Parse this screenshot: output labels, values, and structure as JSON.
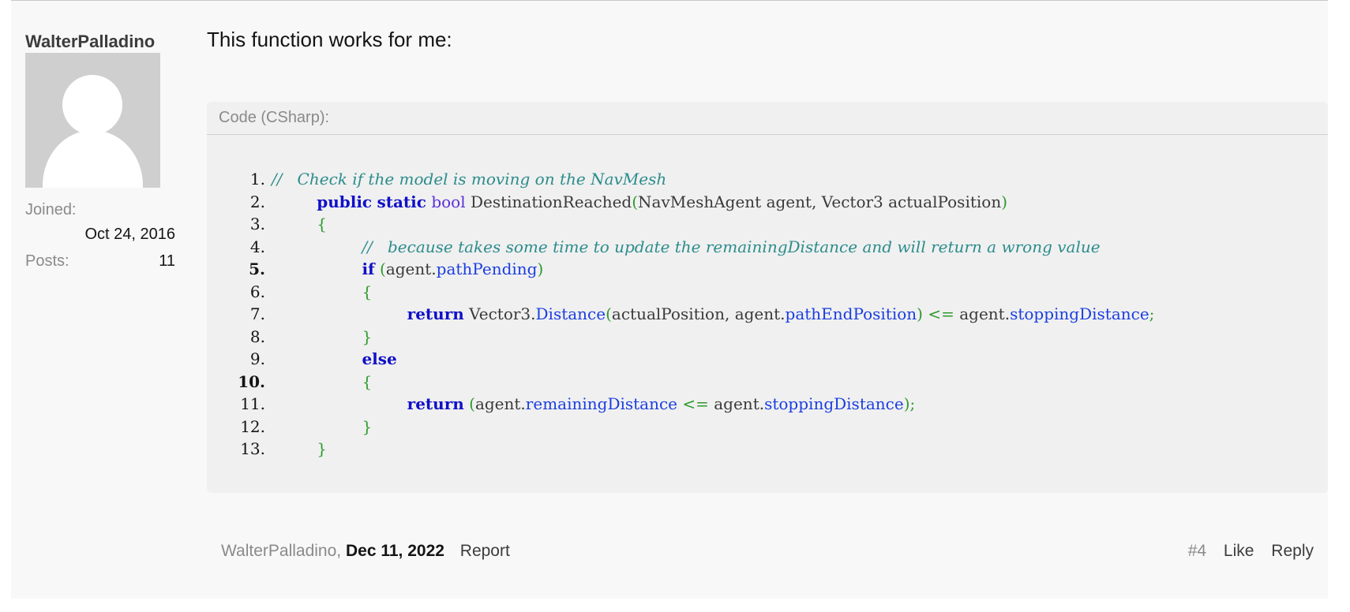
{
  "user": {
    "username": "WalterPalladino",
    "joined_label": "Joined:",
    "joined_value": "Oct 24, 2016",
    "posts_label": "Posts:",
    "posts_value": "11"
  },
  "message": {
    "text": "This function works for me:"
  },
  "code": {
    "header": "Code (CSharp):",
    "lines": [
      {
        "num": "1.",
        "bold": false,
        "tokens": [
          {
            "t": "c-comment",
            "v": "//   Check if the model is moving on the NavMesh"
          }
        ]
      },
      {
        "num": "2.",
        "bold": false,
        "tokens": [
          {
            "t": "c-plain",
            "v": "         "
          },
          {
            "t": "c-kw",
            "v": "public"
          },
          {
            "t": "c-plain",
            "v": " "
          },
          {
            "t": "c-kw",
            "v": "static"
          },
          {
            "t": "c-plain",
            "v": " "
          },
          {
            "t": "c-type",
            "v": "bool"
          },
          {
            "t": "c-plain",
            "v": " DestinationReached"
          },
          {
            "t": "c-punct",
            "v": "("
          },
          {
            "t": "c-plain",
            "v": "NavMeshAgent agent, Vector3 actualPosition"
          },
          {
            "t": "c-punct",
            "v": ")"
          }
        ]
      },
      {
        "num": "3.",
        "bold": false,
        "tokens": [
          {
            "t": "c-plain",
            "v": "         "
          },
          {
            "t": "c-punct",
            "v": "{"
          }
        ]
      },
      {
        "num": "4.",
        "bold": false,
        "tokens": [
          {
            "t": "c-plain",
            "v": "                  "
          },
          {
            "t": "c-comment",
            "v": "//   because takes some time to update the remainingDistance and will return a wrong value"
          }
        ]
      },
      {
        "num": "5.",
        "bold": true,
        "tokens": [
          {
            "t": "c-plain",
            "v": "                  "
          },
          {
            "t": "c-kw",
            "v": "if"
          },
          {
            "t": "c-plain",
            "v": " "
          },
          {
            "t": "c-punct",
            "v": "("
          },
          {
            "t": "c-plain",
            "v": "agent."
          },
          {
            "t": "c-member",
            "v": "pathPending"
          },
          {
            "t": "c-punct",
            "v": ")"
          }
        ]
      },
      {
        "num": "6.",
        "bold": false,
        "tokens": [
          {
            "t": "c-plain",
            "v": "                  "
          },
          {
            "t": "c-punct",
            "v": "{"
          }
        ]
      },
      {
        "num": "7.",
        "bold": false,
        "tokens": [
          {
            "t": "c-plain",
            "v": "                           "
          },
          {
            "t": "c-kw",
            "v": "return"
          },
          {
            "t": "c-plain",
            "v": " Vector3."
          },
          {
            "t": "c-member",
            "v": "Distance"
          },
          {
            "t": "c-punct",
            "v": "("
          },
          {
            "t": "c-plain",
            "v": "actualPosition, agent."
          },
          {
            "t": "c-member",
            "v": "pathEndPosition"
          },
          {
            "t": "c-punct",
            "v": ")"
          },
          {
            "t": "c-plain",
            "v": " "
          },
          {
            "t": "c-punct",
            "v": "<="
          },
          {
            "t": "c-plain",
            "v": " agent."
          },
          {
            "t": "c-member",
            "v": "stoppingDistance"
          },
          {
            "t": "c-punct",
            "v": ";"
          }
        ]
      },
      {
        "num": "8.",
        "bold": false,
        "tokens": [
          {
            "t": "c-plain",
            "v": "                  "
          },
          {
            "t": "c-punct",
            "v": "}"
          }
        ]
      },
      {
        "num": "9.",
        "bold": false,
        "tokens": [
          {
            "t": "c-plain",
            "v": "                  "
          },
          {
            "t": "c-kw",
            "v": "else"
          }
        ]
      },
      {
        "num": "10.",
        "bold": true,
        "tokens": [
          {
            "t": "c-plain",
            "v": "                  "
          },
          {
            "t": "c-punct",
            "v": "{"
          }
        ]
      },
      {
        "num": "11.",
        "bold": false,
        "tokens": [
          {
            "t": "c-plain",
            "v": "                           "
          },
          {
            "t": "c-kw",
            "v": "return"
          },
          {
            "t": "c-plain",
            "v": " "
          },
          {
            "t": "c-punct",
            "v": "("
          },
          {
            "t": "c-plain",
            "v": "agent."
          },
          {
            "t": "c-member",
            "v": "remainingDistance"
          },
          {
            "t": "c-plain",
            "v": " "
          },
          {
            "t": "c-punct",
            "v": "<="
          },
          {
            "t": "c-plain",
            "v": " agent."
          },
          {
            "t": "c-member",
            "v": "stoppingDistance"
          },
          {
            "t": "c-punct",
            "v": ");"
          }
        ]
      },
      {
        "num": "12.",
        "bold": false,
        "tokens": [
          {
            "t": "c-plain",
            "v": "                  "
          },
          {
            "t": "c-punct",
            "v": "}"
          }
        ]
      },
      {
        "num": "13.",
        "bold": false,
        "tokens": [
          {
            "t": "c-plain",
            "v": "         "
          },
          {
            "t": "c-punct",
            "v": "}"
          }
        ]
      }
    ]
  },
  "footer": {
    "author": "WalterPalladino,",
    "date": "Dec 11, 2022",
    "report": "Report",
    "post_number": "#4",
    "like": "Like",
    "reply": "Reply"
  }
}
